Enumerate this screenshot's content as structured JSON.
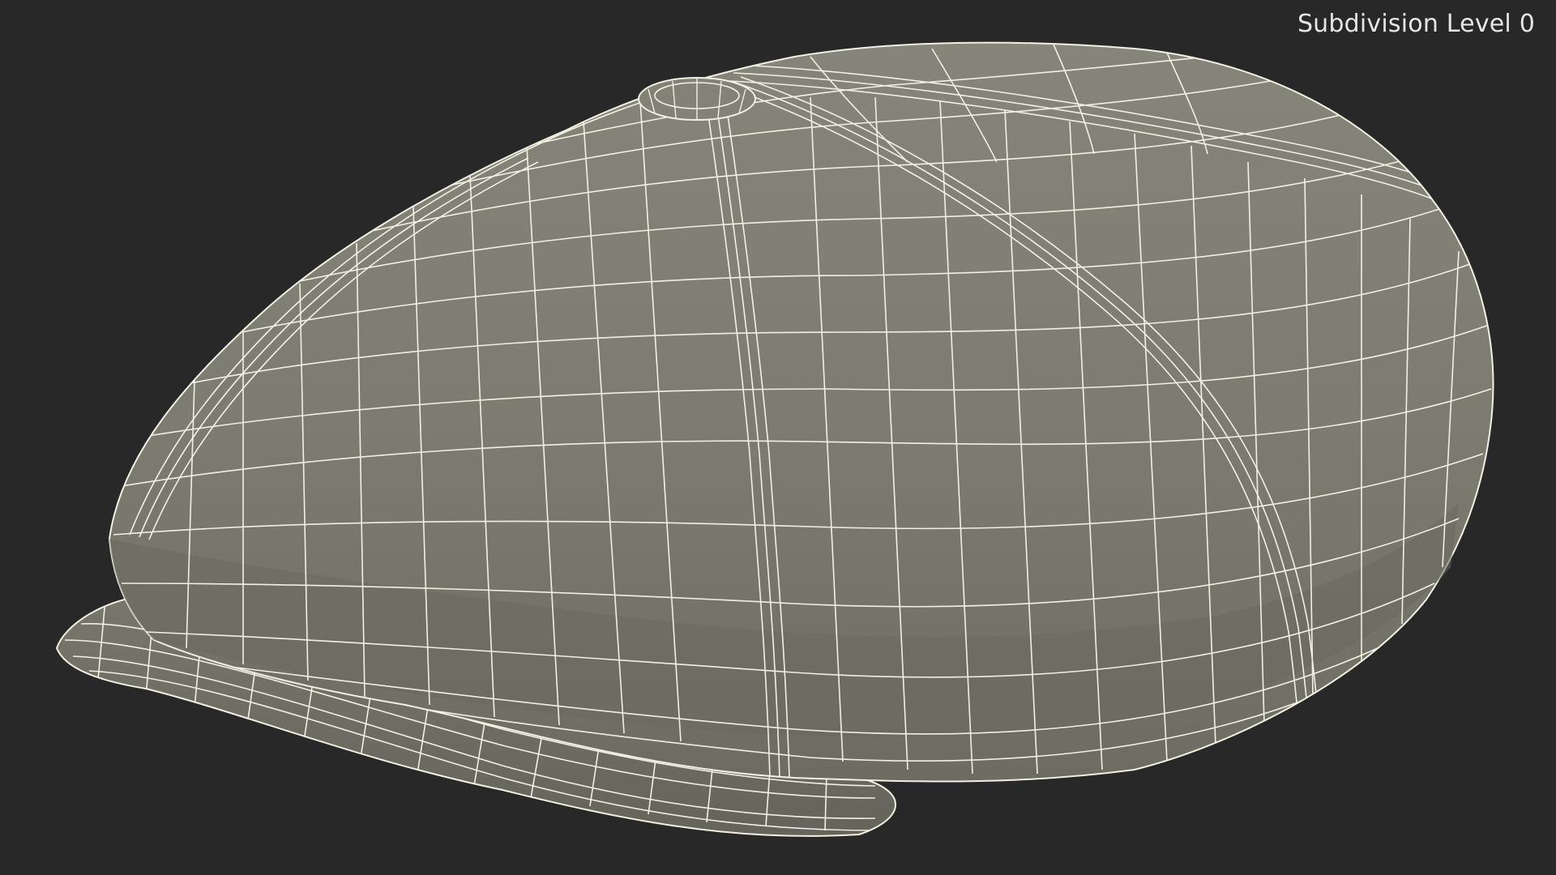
{
  "viewport": {
    "overlay_label": "Subdivision Level 0",
    "background_color": "#282828"
  },
  "model": {
    "subject": "flat cap",
    "shading": "wireframe-on-shaded",
    "surface_color": "#7c7c70",
    "shadow_color": "#63635a",
    "wire_color": "#f2f0e2"
  }
}
